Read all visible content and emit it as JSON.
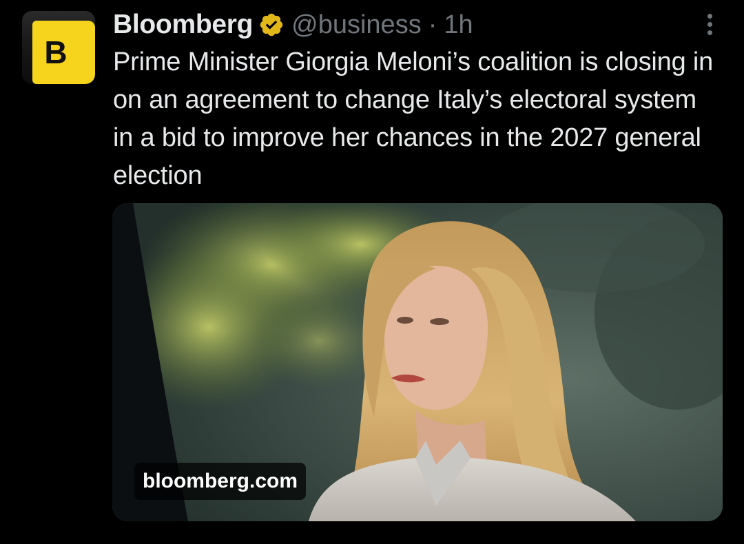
{
  "tweet": {
    "avatar_letter": "B",
    "display_name": "Bloomberg",
    "handle": "@business",
    "separator": "·",
    "time": "1h",
    "text": "Prime Minister Giorgia Meloni’s coalition is closing in on an agreement to change Italy’s electoral system in a bid to improve her chances in the 2027 general election",
    "media": {
      "domain": "bloomberg.com"
    }
  },
  "icons": {
    "verified": "verified-badge-icon",
    "more": "more-options-icon"
  },
  "colors": {
    "background": "#000000",
    "text_primary": "#e7e9ea",
    "text_secondary": "#71767b",
    "verified_gold": "#e2b719",
    "brand_yellow": "#f6d41d"
  }
}
